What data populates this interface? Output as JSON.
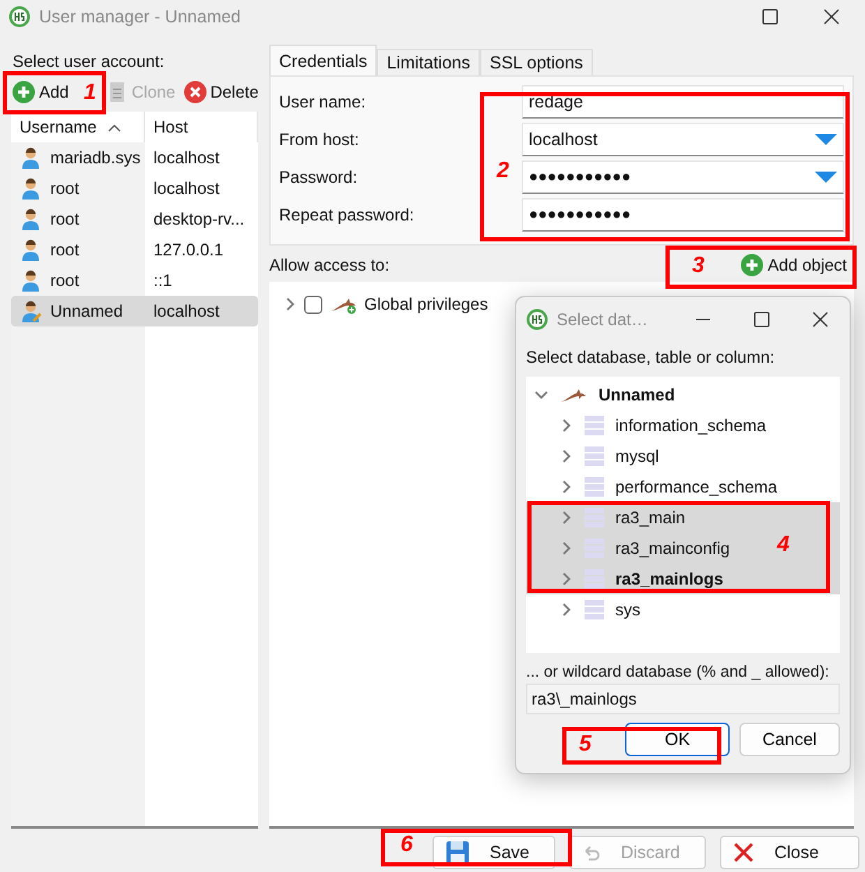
{
  "window": {
    "title": "User manager - Unnamed"
  },
  "accounts": {
    "label": "Select user account:",
    "toolbar": [
      {
        "label": "Add",
        "kind": "add",
        "disabled": false
      },
      {
        "label": "Clone",
        "kind": "clone",
        "disabled": true
      },
      {
        "label": "Delete",
        "kind": "delete",
        "disabled": false
      }
    ],
    "columns": [
      {
        "label": "Username",
        "sorted": true
      },
      {
        "label": "Host",
        "sorted": false
      }
    ],
    "rows": [
      {
        "username": "mariadb.sys",
        "host": "localhost",
        "selected": false
      },
      {
        "username": "root",
        "host": "localhost",
        "selected": false
      },
      {
        "username": "root",
        "host": "desktop-rv...",
        "selected": false
      },
      {
        "username": "root",
        "host": "127.0.0.1",
        "selected": false
      },
      {
        "username": "root",
        "host": "::1",
        "selected": false
      },
      {
        "username": "Unnamed",
        "host": "localhost",
        "selected": true
      }
    ]
  },
  "tabs": [
    {
      "label": "Credentials",
      "selected": true
    },
    {
      "label": "Limitations",
      "selected": false
    },
    {
      "label": "SSL options",
      "selected": false
    }
  ],
  "credentials": [
    {
      "label": "User name:",
      "value": "redage",
      "kind": "text"
    },
    {
      "label": "From host:",
      "value": "localhost",
      "kind": "combo"
    },
    {
      "label": "Password:",
      "value": "●●●●●●●●●●●",
      "kind": "combo"
    },
    {
      "label": "Repeat password:",
      "value": "●●●●●●●●●●●",
      "kind": "text"
    }
  ],
  "access": {
    "label": "Allow access to:",
    "add_button": "Add object",
    "tree": [
      {
        "label": "Global privileges",
        "checked": false,
        "expanded": false
      }
    ]
  },
  "dialog": {
    "title": "Select dat…",
    "prompt": "Select database, table or column:",
    "tree": {
      "label": "Unnamed",
      "expanded": true,
      "children": [
        {
          "label": "information_schema",
          "selected": false,
          "focused": false
        },
        {
          "label": "mysql",
          "selected": false,
          "focused": false
        },
        {
          "label": "performance_schema",
          "selected": false,
          "focused": false
        },
        {
          "label": "ra3_main",
          "selected": true,
          "focused": false
        },
        {
          "label": "ra3_mainconfig",
          "selected": true,
          "focused": false
        },
        {
          "label": "ra3_mainlogs",
          "selected": true,
          "focused": true
        },
        {
          "label": "sys",
          "selected": false,
          "focused": false
        }
      ]
    },
    "wildcard_label": "... or wildcard database (% and _ allowed):",
    "wildcard_value": "ra3\\_mainlogs",
    "buttons": [
      {
        "label": "OK",
        "default": true
      },
      {
        "label": "Cancel",
        "default": false
      }
    ]
  },
  "bottom_buttons": [
    {
      "label": "Save",
      "kind": "save",
      "disabled": false
    },
    {
      "label": "Discard",
      "kind": "discard",
      "disabled": true
    },
    {
      "label": "Close",
      "kind": "close",
      "disabled": false
    }
  ],
  "annotations": [
    {
      "number": "1"
    },
    {
      "number": "2"
    },
    {
      "number": "3"
    },
    {
      "number": "4"
    },
    {
      "number": "5"
    },
    {
      "number": "6"
    }
  ]
}
